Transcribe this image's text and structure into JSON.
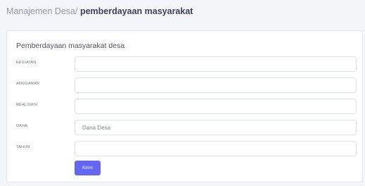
{
  "breadcrumb": {
    "parent": "Manajemen Desa/",
    "current": "pemberdayaan masyarakat"
  },
  "form": {
    "title": "Pemberdayaan masyarakat desa",
    "fields": [
      {
        "label": "KEGIATAN",
        "value": "",
        "placeholder": ""
      },
      {
        "label": "ANGGARAN",
        "value": "",
        "placeholder": ""
      },
      {
        "label": "REALISASI",
        "value": "",
        "placeholder": ""
      },
      {
        "label": "DANA",
        "value": "",
        "placeholder": "Dana Desa"
      },
      {
        "label": "TAHUN",
        "value": "",
        "placeholder": ""
      }
    ],
    "submit_label": "Kirim"
  },
  "colors": {
    "accent": "#6366f1",
    "background": "#f4f5f8",
    "card": "#ffffff"
  }
}
